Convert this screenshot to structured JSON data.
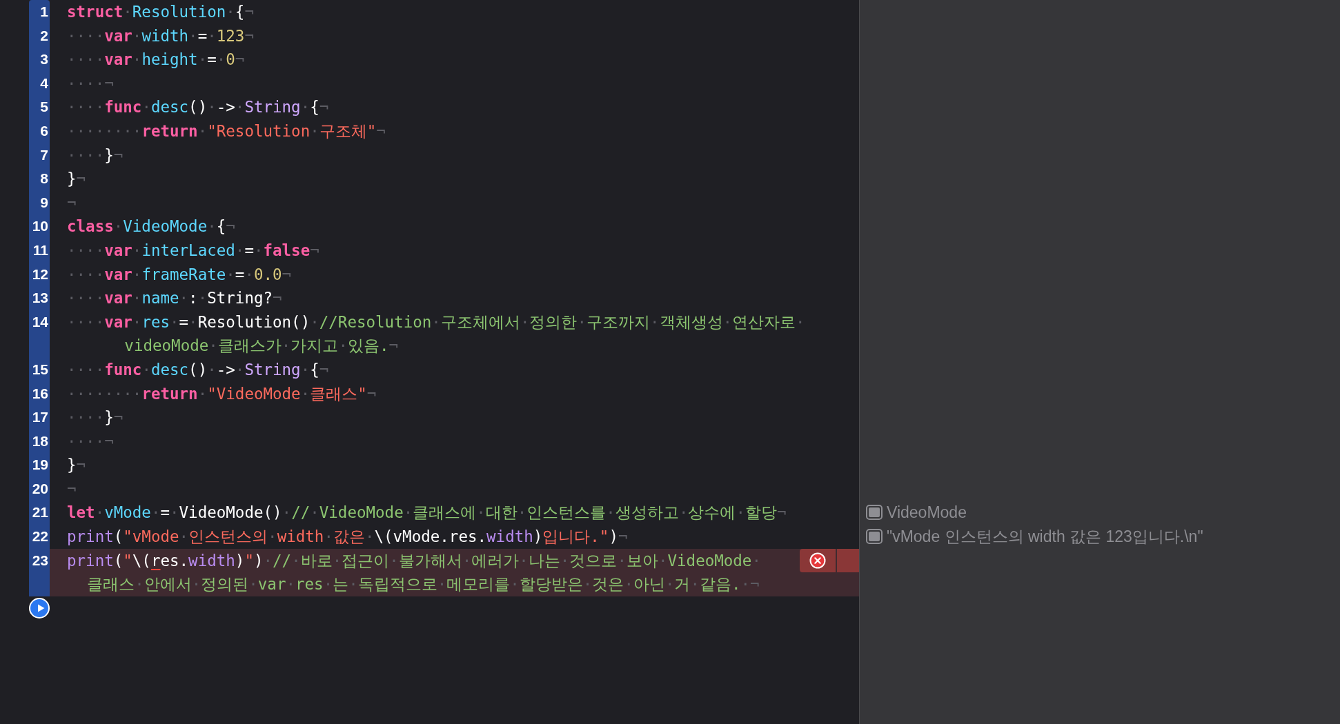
{
  "lines": [
    {
      "number": "1",
      "error": false,
      "segments": [
        {
          "kind": "kw",
          "text": "struct"
        },
        {
          "kind": "ws",
          "text": "·"
        },
        {
          "kind": "decl",
          "text": "Resolution"
        },
        {
          "kind": "ws",
          "text": "·"
        },
        {
          "kind": "plain",
          "text": "{"
        },
        {
          "kind": "ws",
          "text": "¬"
        }
      ]
    },
    {
      "number": "2",
      "error": false,
      "segments": [
        {
          "kind": "ws",
          "text": "····"
        },
        {
          "kind": "kw",
          "text": "var"
        },
        {
          "kind": "ws",
          "text": "·"
        },
        {
          "kind": "decl",
          "text": "width"
        },
        {
          "kind": "ws",
          "text": "·"
        },
        {
          "kind": "plain",
          "text": "="
        },
        {
          "kind": "ws",
          "text": "·"
        },
        {
          "kind": "num",
          "text": "123"
        },
        {
          "kind": "ws",
          "text": "¬"
        }
      ]
    },
    {
      "number": "3",
      "error": false,
      "segments": [
        {
          "kind": "ws",
          "text": "····"
        },
        {
          "kind": "kw",
          "text": "var"
        },
        {
          "kind": "ws",
          "text": "·"
        },
        {
          "kind": "decl",
          "text": "height"
        },
        {
          "kind": "ws",
          "text": "·"
        },
        {
          "kind": "plain",
          "text": "="
        },
        {
          "kind": "ws",
          "text": "·"
        },
        {
          "kind": "num",
          "text": "0"
        },
        {
          "kind": "ws",
          "text": "¬"
        }
      ]
    },
    {
      "number": "4",
      "error": false,
      "segments": [
        {
          "kind": "ws",
          "text": "····¬"
        }
      ]
    },
    {
      "number": "5",
      "error": false,
      "segments": [
        {
          "kind": "ws",
          "text": "····"
        },
        {
          "kind": "kw",
          "text": "func"
        },
        {
          "kind": "ws",
          "text": "·"
        },
        {
          "kind": "decl",
          "text": "desc"
        },
        {
          "kind": "plain",
          "text": "()"
        },
        {
          "kind": "ws",
          "text": "·"
        },
        {
          "kind": "plain",
          "text": "->"
        },
        {
          "kind": "ws",
          "text": "·"
        },
        {
          "kind": "type",
          "text": "String"
        },
        {
          "kind": "ws",
          "text": "·"
        },
        {
          "kind": "plain",
          "text": "{"
        },
        {
          "kind": "ws",
          "text": "¬"
        }
      ]
    },
    {
      "number": "6",
      "error": false,
      "segments": [
        {
          "kind": "ws",
          "text": "········"
        },
        {
          "kind": "kw",
          "text": "return"
        },
        {
          "kind": "ws",
          "text": "·"
        },
        {
          "kind": "str",
          "text": "\"Resolution"
        },
        {
          "kind": "ws",
          "text": "·"
        },
        {
          "kind": "str",
          "text": "구조체\""
        },
        {
          "kind": "ws",
          "text": "¬"
        }
      ]
    },
    {
      "number": "7",
      "error": false,
      "segments": [
        {
          "kind": "ws",
          "text": "····"
        },
        {
          "kind": "plain",
          "text": "}"
        },
        {
          "kind": "ws",
          "text": "¬"
        }
      ]
    },
    {
      "number": "8",
      "error": false,
      "segments": [
        {
          "kind": "plain",
          "text": "}"
        },
        {
          "kind": "ws",
          "text": "¬"
        }
      ]
    },
    {
      "number": "9",
      "error": false,
      "segments": [
        {
          "kind": "ws",
          "text": "¬"
        }
      ]
    },
    {
      "number": "10",
      "error": false,
      "segments": [
        {
          "kind": "kw",
          "text": "class"
        },
        {
          "kind": "ws",
          "text": "·"
        },
        {
          "kind": "decl",
          "text": "VideoMode"
        },
        {
          "kind": "ws",
          "text": "·"
        },
        {
          "kind": "plain",
          "text": "{"
        },
        {
          "kind": "ws",
          "text": "¬"
        }
      ]
    },
    {
      "number": "11",
      "error": false,
      "segments": [
        {
          "kind": "ws",
          "text": "····"
        },
        {
          "kind": "kw",
          "text": "var"
        },
        {
          "kind": "ws",
          "text": "·"
        },
        {
          "kind": "decl",
          "text": "interLaced"
        },
        {
          "kind": "ws",
          "text": "·"
        },
        {
          "kind": "plain",
          "text": "="
        },
        {
          "kind": "ws",
          "text": "·"
        },
        {
          "kind": "kw",
          "text": "false"
        },
        {
          "kind": "ws",
          "text": "¬"
        }
      ]
    },
    {
      "number": "12",
      "error": false,
      "segments": [
        {
          "kind": "ws",
          "text": "····"
        },
        {
          "kind": "kw",
          "text": "var"
        },
        {
          "kind": "ws",
          "text": "·"
        },
        {
          "kind": "decl",
          "text": "frameRate"
        },
        {
          "kind": "ws",
          "text": "·"
        },
        {
          "kind": "plain",
          "text": "="
        },
        {
          "kind": "ws",
          "text": "·"
        },
        {
          "kind": "num",
          "text": "0.0"
        },
        {
          "kind": "ws",
          "text": "¬"
        }
      ]
    },
    {
      "number": "13",
      "error": false,
      "segments": [
        {
          "kind": "ws",
          "text": "····"
        },
        {
          "kind": "kw",
          "text": "var"
        },
        {
          "kind": "ws",
          "text": "·"
        },
        {
          "kind": "decl",
          "text": "name"
        },
        {
          "kind": "ws",
          "text": "·"
        },
        {
          "kind": "plain",
          "text": ":"
        },
        {
          "kind": "ws",
          "text": "·"
        },
        {
          "kind": "plain",
          "text": "String?"
        },
        {
          "kind": "ws",
          "text": "¬"
        }
      ]
    },
    {
      "number": "14",
      "error": false,
      "segments": [
        {
          "kind": "ws",
          "text": "····"
        },
        {
          "kind": "kw",
          "text": "var"
        },
        {
          "kind": "ws",
          "text": "·"
        },
        {
          "kind": "decl",
          "text": "res"
        },
        {
          "kind": "ws",
          "text": "·"
        },
        {
          "kind": "plain",
          "text": "="
        },
        {
          "kind": "ws",
          "text": "·"
        },
        {
          "kind": "plain",
          "text": "Resolution()"
        },
        {
          "kind": "ws",
          "text": "·"
        },
        {
          "kind": "com",
          "text": "//Resolution"
        },
        {
          "kind": "ws",
          "text": "·"
        },
        {
          "kind": "com",
          "text": "구조체에서"
        },
        {
          "kind": "ws",
          "text": "·"
        },
        {
          "kind": "com",
          "text": "정의한"
        },
        {
          "kind": "ws",
          "text": "·"
        },
        {
          "kind": "com",
          "text": "구조까지"
        },
        {
          "kind": "ws",
          "text": "·"
        },
        {
          "kind": "com",
          "text": "객체생성"
        },
        {
          "kind": "ws",
          "text": "·"
        },
        {
          "kind": "com",
          "text": "연산자로"
        },
        {
          "kind": "ws",
          "text": "·"
        }
      ],
      "wrap": [
        {
          "kind": "com",
          "text": "videoMode"
        },
        {
          "kind": "ws",
          "text": "·"
        },
        {
          "kind": "com",
          "text": "클래스가"
        },
        {
          "kind": "ws",
          "text": "·"
        },
        {
          "kind": "com",
          "text": "가지고"
        },
        {
          "kind": "ws",
          "text": "·"
        },
        {
          "kind": "com",
          "text": "있음."
        },
        {
          "kind": "ws",
          "text": "¬"
        }
      ]
    },
    {
      "number": "15",
      "error": false,
      "segments": [
        {
          "kind": "ws",
          "text": "····"
        },
        {
          "kind": "kw",
          "text": "func"
        },
        {
          "kind": "ws",
          "text": "·"
        },
        {
          "kind": "decl",
          "text": "desc"
        },
        {
          "kind": "plain",
          "text": "()"
        },
        {
          "kind": "ws",
          "text": "·"
        },
        {
          "kind": "plain",
          "text": "->"
        },
        {
          "kind": "ws",
          "text": "·"
        },
        {
          "kind": "type",
          "text": "String"
        },
        {
          "kind": "ws",
          "text": "·"
        },
        {
          "kind": "plain",
          "text": "{"
        },
        {
          "kind": "ws",
          "text": "¬"
        }
      ]
    },
    {
      "number": "16",
      "error": false,
      "segments": [
        {
          "kind": "ws",
          "text": "········"
        },
        {
          "kind": "kw",
          "text": "return"
        },
        {
          "kind": "ws",
          "text": "·"
        },
        {
          "kind": "str",
          "text": "\"VideoMode"
        },
        {
          "kind": "ws",
          "text": "·"
        },
        {
          "kind": "str",
          "text": "클래스\""
        },
        {
          "kind": "ws",
          "text": "¬"
        }
      ]
    },
    {
      "number": "17",
      "error": false,
      "segments": [
        {
          "kind": "ws",
          "text": "····"
        },
        {
          "kind": "plain",
          "text": "}"
        },
        {
          "kind": "ws",
          "text": "¬"
        }
      ]
    },
    {
      "number": "18",
      "error": false,
      "segments": [
        {
          "kind": "ws",
          "text": "····¬"
        }
      ]
    },
    {
      "number": "19",
      "error": false,
      "segments": [
        {
          "kind": "plain",
          "text": "}"
        },
        {
          "kind": "ws",
          "text": "¬"
        }
      ]
    },
    {
      "number": "20",
      "error": false,
      "segments": [
        {
          "kind": "ws",
          "text": "¬"
        }
      ]
    },
    {
      "number": "21",
      "error": false,
      "result": "VideoMode",
      "segments": [
        {
          "kind": "kw",
          "text": "let"
        },
        {
          "kind": "ws",
          "text": "·"
        },
        {
          "kind": "decl",
          "text": "vMode"
        },
        {
          "kind": "ws",
          "text": "·"
        },
        {
          "kind": "plain",
          "text": "="
        },
        {
          "kind": "ws",
          "text": "·"
        },
        {
          "kind": "plain",
          "text": "VideoMode()"
        },
        {
          "kind": "ws",
          "text": "·"
        },
        {
          "kind": "com",
          "text": "//"
        },
        {
          "kind": "ws",
          "text": "·"
        },
        {
          "kind": "com",
          "text": "VideoMode"
        },
        {
          "kind": "ws",
          "text": "·"
        },
        {
          "kind": "com",
          "text": "클래스에"
        },
        {
          "kind": "ws",
          "text": "·"
        },
        {
          "kind": "com",
          "text": "대한"
        },
        {
          "kind": "ws",
          "text": "·"
        },
        {
          "kind": "com",
          "text": "인스턴스를"
        },
        {
          "kind": "ws",
          "text": "·"
        },
        {
          "kind": "com",
          "text": "생성하고"
        },
        {
          "kind": "ws",
          "text": "·"
        },
        {
          "kind": "com",
          "text": "상수에"
        },
        {
          "kind": "ws",
          "text": "·"
        },
        {
          "kind": "com",
          "text": "할당"
        },
        {
          "kind": "ws",
          "text": "¬"
        }
      ]
    },
    {
      "number": "22",
      "error": false,
      "result": "\"vMode 인스턴스의 width 값은 123입니다.\\n\"",
      "segments": [
        {
          "kind": "ref",
          "text": "print"
        },
        {
          "kind": "plain",
          "text": "("
        },
        {
          "kind": "str",
          "text": "\"vMode"
        },
        {
          "kind": "ws",
          "text": "·"
        },
        {
          "kind": "str",
          "text": "인스턴스의"
        },
        {
          "kind": "ws",
          "text": "·"
        },
        {
          "kind": "str",
          "text": "width"
        },
        {
          "kind": "ws",
          "text": "·"
        },
        {
          "kind": "str",
          "text": "값은"
        },
        {
          "kind": "ws",
          "text": "·"
        },
        {
          "kind": "plain",
          "text": "\\(vMode.res."
        },
        {
          "kind": "ref",
          "text": "width"
        },
        {
          "kind": "plain",
          "text": ")"
        },
        {
          "kind": "str",
          "text": "입니다.\""
        },
        {
          "kind": "plain",
          "text": ")"
        },
        {
          "kind": "ws",
          "text": "¬"
        }
      ]
    },
    {
      "number": "23",
      "error": true,
      "segments": [
        {
          "kind": "ref",
          "text": "print"
        },
        {
          "kind": "plain",
          "text": "("
        },
        {
          "kind": "str",
          "text": "\""
        },
        {
          "kind": "plain",
          "text": "\\("
        },
        {
          "kind": "flag",
          "text": "r"
        },
        {
          "kind": "plain",
          "text": "es."
        },
        {
          "kind": "ref",
          "text": "width"
        },
        {
          "kind": "plain",
          "text": ")"
        },
        {
          "kind": "str",
          "text": "\""
        },
        {
          "kind": "plain",
          "text": ")"
        },
        {
          "kind": "ws",
          "text": "·"
        },
        {
          "kind": "com",
          "text": "//"
        },
        {
          "kind": "ws",
          "text": "·"
        },
        {
          "kind": "com",
          "text": "바로"
        },
        {
          "kind": "ws",
          "text": "·"
        },
        {
          "kind": "com",
          "text": "접근이"
        },
        {
          "kind": "ws",
          "text": "·"
        },
        {
          "kind": "com",
          "text": "불가해서"
        },
        {
          "kind": "ws",
          "text": "·"
        },
        {
          "kind": "com",
          "text": "에러가"
        },
        {
          "kind": "ws",
          "text": "·"
        },
        {
          "kind": "com",
          "text": "나는"
        },
        {
          "kind": "ws",
          "text": "·"
        },
        {
          "kind": "com",
          "text": "것으로"
        },
        {
          "kind": "ws",
          "text": "·"
        },
        {
          "kind": "com",
          "text": "보아"
        },
        {
          "kind": "ws",
          "text": "·"
        },
        {
          "kind": "com",
          "text": "VideoMode"
        },
        {
          "kind": "ws",
          "text": "·"
        }
      ],
      "wrap": [
        {
          "kind": "com",
          "text": "클래스"
        },
        {
          "kind": "ws",
          "text": "·"
        },
        {
          "kind": "com",
          "text": "안에서"
        },
        {
          "kind": "ws",
          "text": "·"
        },
        {
          "kind": "com",
          "text": "정의된"
        },
        {
          "kind": "ws",
          "text": "·"
        },
        {
          "kind": "com",
          "text": "var"
        },
        {
          "kind": "ws",
          "text": "·"
        },
        {
          "kind": "com",
          "text": "res"
        },
        {
          "kind": "ws",
          "text": "·"
        },
        {
          "kind": "com",
          "text": "는"
        },
        {
          "kind": "ws",
          "text": "·"
        },
        {
          "kind": "com",
          "text": "독립적으로"
        },
        {
          "kind": "ws",
          "text": "·"
        },
        {
          "kind": "com",
          "text": "메모리를"
        },
        {
          "kind": "ws",
          "text": "·"
        },
        {
          "kind": "com",
          "text": "할당받은"
        },
        {
          "kind": "ws",
          "text": "·"
        },
        {
          "kind": "com",
          "text": "것은"
        },
        {
          "kind": "ws",
          "text": "·"
        },
        {
          "kind": "com",
          "text": "아닌"
        },
        {
          "kind": "ws",
          "text": "·"
        },
        {
          "kind": "com",
          "text": "거"
        },
        {
          "kind": "ws",
          "text": "·"
        },
        {
          "kind": "com",
          "text": "같음."
        },
        {
          "kind": "ws",
          "text": "·¬"
        }
      ]
    }
  ]
}
